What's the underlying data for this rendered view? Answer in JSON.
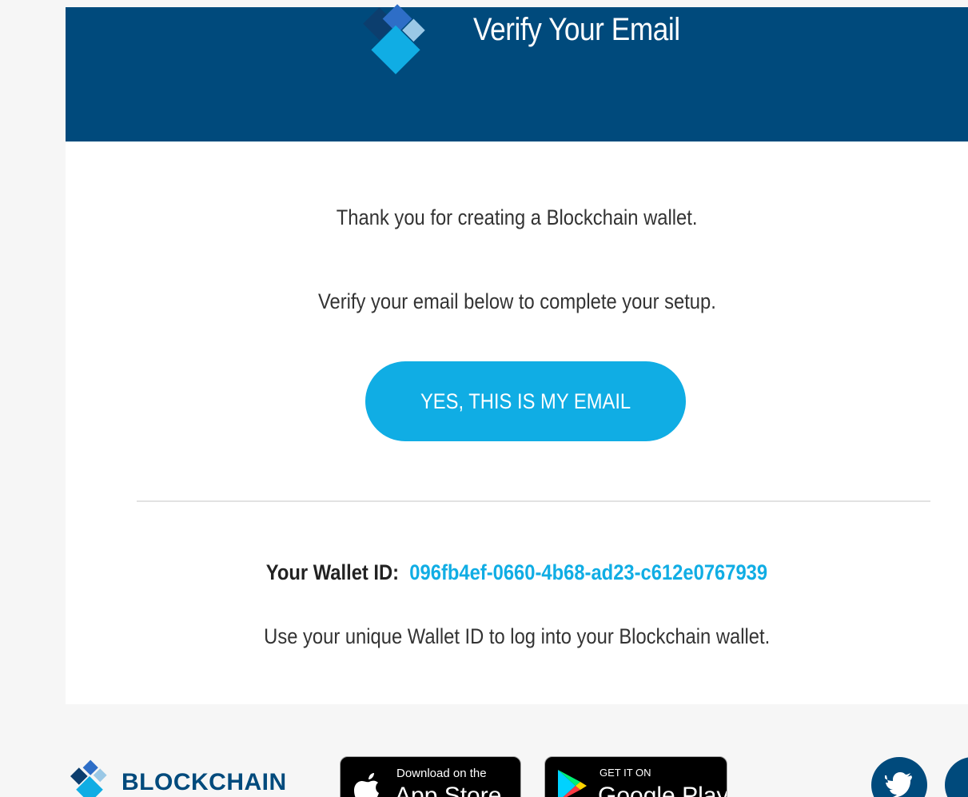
{
  "header": {
    "title": "Verify Your Email",
    "background_color": "#004a7c"
  },
  "body": {
    "thank_you_text": "Thank you for creating a Blockchain wallet.",
    "instruction_text": "Verify your email below to complete your setup.",
    "confirm_button_label": "YES, THIS IS MY EMAIL",
    "wallet_id_label": "Your Wallet ID:",
    "wallet_id_value": "096fb4ef-0660-4b68-ad23-c612e0767939",
    "wallet_id_hint": "Use your unique Wallet ID to log into your Blockchain wallet.",
    "accent_color": "#10ade4"
  },
  "footer": {
    "brand_name": "BLOCKCHAIN",
    "app_store": {
      "small_text": "Download on the",
      "big_text": "App Store"
    },
    "google_play": {
      "small_text": "GET IT ON",
      "big_text": "Google Play"
    },
    "social_icons": [
      "twitter-icon",
      "social-icon"
    ]
  }
}
